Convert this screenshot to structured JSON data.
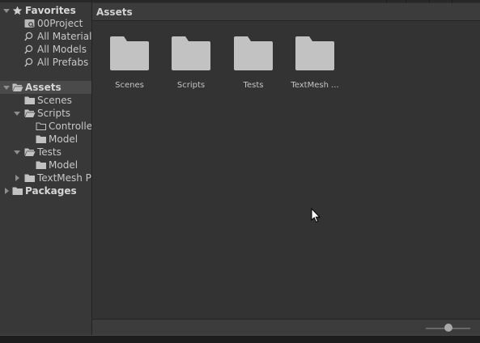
{
  "tree": {
    "favorites": {
      "label": "Favorites",
      "items": [
        "00Project",
        "All Materials",
        "All Models",
        "All Prefabs"
      ]
    },
    "assets": {
      "label": "Assets",
      "children": {
        "scenes": "Scenes",
        "scripts": "Scripts",
        "scripts_controllers": "Controlle",
        "scripts_model": "Model",
        "tests": "Tests",
        "tests_model": "Model",
        "textmesh": "TextMesh P"
      }
    },
    "packages": {
      "label": "Packages"
    }
  },
  "breadcrumb": {
    "label": "Assets"
  },
  "grid": {
    "items": [
      "Scenes",
      "Scripts",
      "Tests",
      "TextMesh ..."
    ]
  },
  "zoom_slider": {
    "level_fraction": 0.5
  },
  "colors": {
    "folder_fill": "#c2c2c2",
    "selected_row": "#4a4a4a",
    "panel_bg": "#333333"
  }
}
